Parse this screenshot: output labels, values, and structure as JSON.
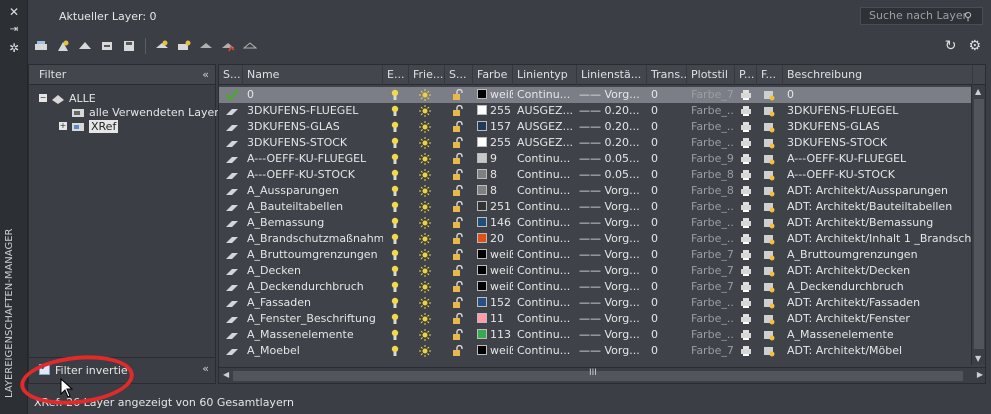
{
  "strip": {
    "title": "LAYEREIGENSCHAFTEN-MANAGER"
  },
  "header": {
    "current_layer": "Aktueller Layer: 0",
    "search_placeholder": "Suche nach Layer"
  },
  "filter_panel": {
    "header": "Filter",
    "tree": [
      {
        "label": "ALLE",
        "level": 0,
        "expanded": true
      },
      {
        "label": "alle Verwendeten Layer",
        "level": 1
      },
      {
        "label": "XRef",
        "level": 1,
        "expanded": false
      }
    ],
    "invert_label": "Filter invertie",
    "invert_checked": true
  },
  "columns": [
    "S...",
    "Name",
    "E...",
    "Frie...",
    "S...",
    "Farbe",
    "Linientyp",
    "Linienstä...",
    "Trans...",
    "Plotstil",
    "P...",
    "F...",
    "Beschreibung"
  ],
  "layers": [
    {
      "name": "0",
      "color_name": "weiß",
      "color_hex": "#000000",
      "linetype": "Continu...",
      "lineweight": "Vorg...",
      "transparency": "0",
      "plotstyle": "Farbe_7",
      "desc": "0",
      "current": true,
      "selected": true
    },
    {
      "name": "3DKUFENS-FLUEGEL",
      "color_name": "255",
      "color_hex": "#ffffff",
      "linetype": "AUSGEZ...",
      "lineweight": "0.20...",
      "transparency": "0",
      "plotstyle": "Farbe_...",
      "desc": "3DKUFENS-FLUEGEL"
    },
    {
      "name": "3DKUFENS-GLAS",
      "color_name": "157",
      "color_hex": "#1f3a5a",
      "linetype": "AUSGEZ...",
      "lineweight": "0.20...",
      "transparency": "0",
      "plotstyle": "Farbe_...",
      "desc": "3DKUFENS-GLAS"
    },
    {
      "name": "3DKUFENS-STOCK",
      "color_name": "255",
      "color_hex": "#ffffff",
      "linetype": "AUSGEZ...",
      "lineweight": "0.20...",
      "transparency": "0",
      "plotstyle": "Farbe_...",
      "desc": "3DKUFENS-STOCK"
    },
    {
      "name": "A---OEFF-KU-FLUEGEL",
      "color_name": "9",
      "color_hex": "#c8c8c8",
      "linetype": "Continu...",
      "lineweight": "0.05...",
      "transparency": "0",
      "plotstyle": "Farbe_9",
      "desc": "A---OEFF-KU-FLUEGEL"
    },
    {
      "name": "A---OEFF-KU-STOCK",
      "color_name": "8",
      "color_hex": "#808080",
      "linetype": "Continu...",
      "lineweight": "0.05...",
      "transparency": "0",
      "plotstyle": "Farbe_8",
      "desc": "A---OEFF-KU-STOCK"
    },
    {
      "name": "A_Aussparungen",
      "color_name": "8",
      "color_hex": "#808080",
      "linetype": "Continu...",
      "lineweight": "Vorg...",
      "transparency": "0",
      "plotstyle": "Farbe_8",
      "desc": "ADT: Architekt/Aussparungen"
    },
    {
      "name": "A_Bauteiltabellen",
      "color_name": "251",
      "color_hex": "#333333",
      "linetype": "Continu...",
      "lineweight": "Vorg...",
      "transparency": "0",
      "plotstyle": "Farbe_...",
      "desc": "ADT: Architekt/Bauteiltabellen"
    },
    {
      "name": "A_Bemassung",
      "color_name": "146",
      "color_hex": "#1f4e78",
      "linetype": "Continu...",
      "lineweight": "Vorg...",
      "transparency": "0",
      "plotstyle": "Farbe_...",
      "desc": "ADT: Architekt/Bemassung"
    },
    {
      "name": "A_Brandschutzmaßnahmen",
      "color_name": "20",
      "color_hex": "#e0501a",
      "linetype": "Continu...",
      "lineweight": "Vorg...",
      "transparency": "0",
      "plotstyle": "Farbe_...",
      "desc": "ADT:  Architekt/Inhalt 1 _Brandschutz"
    },
    {
      "name": "A_Bruttoumgrenzungen",
      "color_name": "weiß",
      "color_hex": "#000000",
      "linetype": "Continu...",
      "lineweight": "Vorg...",
      "transparency": "0",
      "plotstyle": "Farbe_7",
      "desc": "A_Bruttoumgrenzungen"
    },
    {
      "name": "A_Decken",
      "color_name": "weiß",
      "color_hex": "#000000",
      "linetype": "Continu...",
      "lineweight": "Vorg...",
      "transparency": "0",
      "plotstyle": "Farbe_7",
      "desc": "ADT: Architekt/Decken"
    },
    {
      "name": "A_Deckendurchbruch",
      "color_name": "weiß",
      "color_hex": "#000000",
      "linetype": "Continu...",
      "lineweight": "Vorg...",
      "transparency": "0",
      "plotstyle": "Farbe_7",
      "desc": "A_Deckendurchbruch"
    },
    {
      "name": "A_Fassaden",
      "color_name": "152",
      "color_hex": "#2a4f86",
      "linetype": "Continu...",
      "lineweight": "Vorg...",
      "transparency": "0",
      "plotstyle": "Farbe_...",
      "desc": "ADT: Architekt/Fassaden"
    },
    {
      "name": "A_Fenster_Beschriftung",
      "color_name": "11",
      "color_hex": "#ff9ca8",
      "linetype": "Continu...",
      "lineweight": "Vorg...",
      "transparency": "0",
      "plotstyle": "Farbe_...",
      "desc": "ADT: Architekt/Fenster"
    },
    {
      "name": "A_Massenelemente",
      "color_name": "113",
      "color_hex": "#3aa850",
      "linetype": "Continu...",
      "lineweight": "Vorg...",
      "transparency": "0",
      "plotstyle": "Farbe_...",
      "desc": "A_Massenelemente"
    },
    {
      "name": "A_Moebel",
      "color_name": "weiß",
      "color_hex": "#000000",
      "linetype": "Continu...",
      "lineweight": "Vorg...",
      "transparency": "0",
      "plotstyle": "Farbe_7",
      "desc": "ADT: Architekt/Möbel"
    }
  ],
  "status": "XRef: 26 Layer angezeigt von 60 Gesamtlayern",
  "colors": {
    "bg": "#3b3e45",
    "selected_row": "#7b7e86",
    "annotation": "#e32a2a",
    "current_check": "#4ca82e"
  }
}
